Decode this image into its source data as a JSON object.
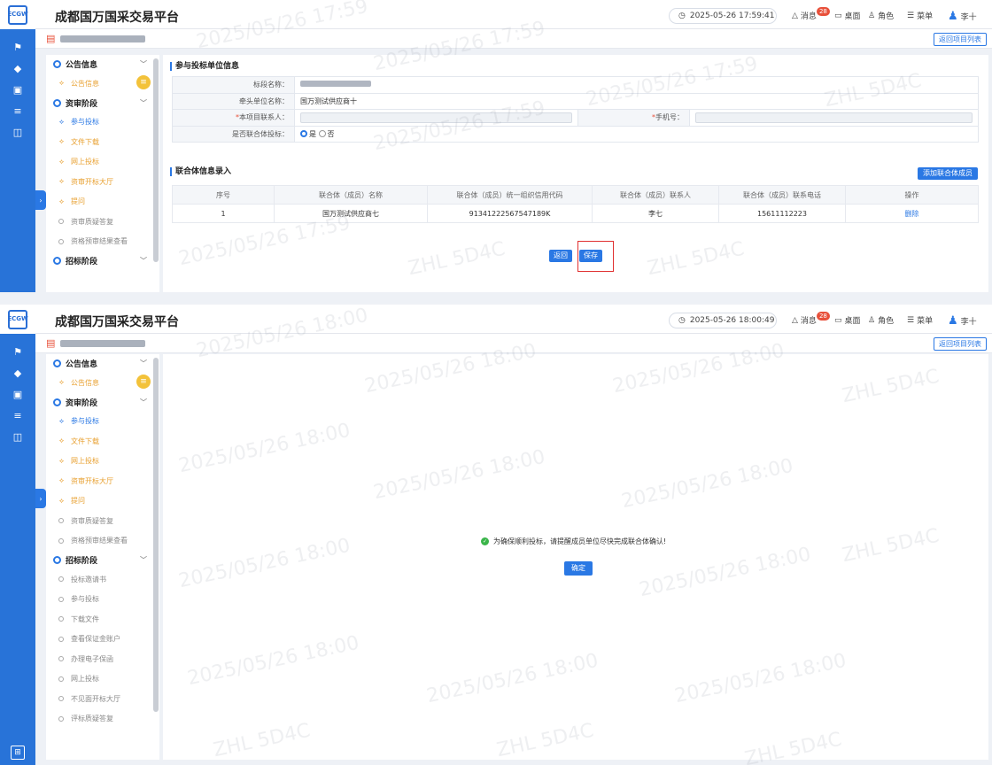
{
  "app": {
    "title": "成都国万国采交易平台",
    "logo_text": "ECGW"
  },
  "screen1": {
    "time": "2025-05-26 17:59:41"
  },
  "screen2": {
    "time": "2025-05-26 18:00:49"
  },
  "topnav": {
    "messages": "消息",
    "msg_count": "28",
    "desktop": "桌面",
    "role": "角色",
    "menu": "菜单",
    "user": "李十"
  },
  "crumb": {
    "back_to_list": "返回项目列表"
  },
  "sidebar": {
    "g1": "公告信息",
    "g1_item": "公告信息",
    "g2": "资审阶段",
    "g2_items": [
      "参与投标",
      "文件下载",
      "网上投标",
      "资审开标大厅",
      "提问",
      "资审质疑答复",
      "资格预审结果查看"
    ],
    "g3": "招标阶段",
    "g3_items": [
      "投标邀请书",
      "参与投标",
      "下载文件",
      "查看保证金账户",
      "办理电子保函",
      "网上投标",
      "不见面开标大厅",
      "评标质疑答复"
    ]
  },
  "form": {
    "section": "参与投标单位信息",
    "l_name": "标段名称：",
    "v_name": "",
    "l_lead": "牵头单位名称：",
    "v_lead": "国万测试供应商十",
    "l_contact": "本项目联系人：",
    "l_phone": "手机号：",
    "l_joint": "是否联合体投标：",
    "yes": "是",
    "no": "否"
  },
  "joint": {
    "section": "联合体信息录入",
    "add": "添加联合体成员",
    "headers": [
      "序号",
      "联合体（成员）名称",
      "联合体（成员）统一组织信用代码",
      "联合体（成员）联系人",
      "联合体（成员）联系电话",
      "操作"
    ],
    "rows": [
      {
        "no": "1",
        "name": "国万测试供应商七",
        "code": "91341222567547189K",
        "contact": "李七",
        "phone": "15611112223",
        "op": "删除"
      }
    ]
  },
  "buttons": {
    "back": "返回",
    "save": "保存"
  },
  "dialog": {
    "message": "为确保顺利投标，请提醒成员单位尽快完成联合体确认!",
    "confirm": "确定"
  },
  "watermark": {
    "code": "ZHL 5D4C",
    "d1": "2025/05/26 17:59",
    "d2": "2025/05/26 18:00"
  },
  "colors": {
    "primary": "#2a78e4",
    "rail": "#2873d8",
    "warn": "#e8503a",
    "success": "#3bb54a",
    "highlight": "#e03030"
  }
}
